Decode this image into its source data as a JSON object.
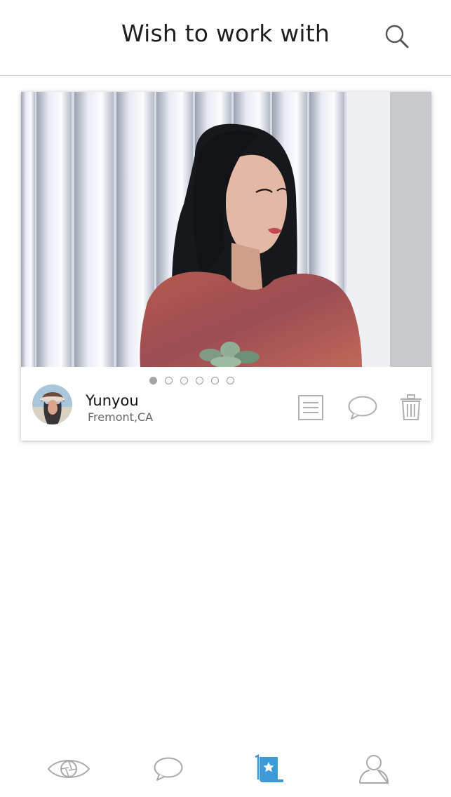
{
  "header": {
    "title": "Wish to work with",
    "search_icon": "search-icon"
  },
  "card": {
    "photo_pagination": {
      "total": 6,
      "current": 1
    },
    "user": {
      "name": "Yunyou",
      "location": "Fremont,CA"
    },
    "actions": [
      "notes-icon",
      "chat-bubble-icon",
      "trash-icon"
    ]
  },
  "tabbar": {
    "items": [
      "eye-aperture-icon",
      "chat-bubble-icon",
      "wishlist-scroll-star-icon",
      "profile-icon"
    ],
    "active_index": 2
  },
  "colors": {
    "accent": "#3d9ad9",
    "icon_gray": "#a9a9a9",
    "divider": "#c9c9c9"
  }
}
